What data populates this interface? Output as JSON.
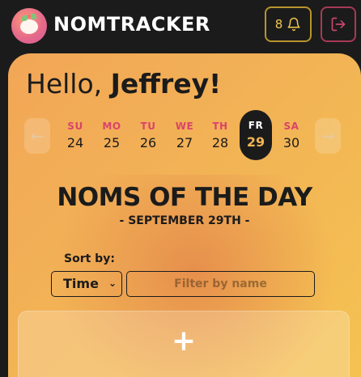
{
  "header": {
    "app_name": "NOMTRACKER",
    "notification_count": "8",
    "icons": {
      "logo": "nomtracker-logo-icon",
      "bell": "bell-icon",
      "logout": "logout-icon"
    }
  },
  "greeting": {
    "prefix": "Hello, ",
    "name": "Jeffrey!"
  },
  "week": {
    "prev_icon": "arrow-left-icon",
    "next_icon": "arrow-right-icon",
    "days": [
      {
        "label": "SU",
        "date": "24"
      },
      {
        "label": "MO",
        "date": "25"
      },
      {
        "label": "TU",
        "date": "26"
      },
      {
        "label": "WE",
        "date": "27"
      },
      {
        "label": "TH",
        "date": "28"
      },
      {
        "label": "FR",
        "date": "29",
        "selected": true
      },
      {
        "label": "SA",
        "date": "30"
      }
    ]
  },
  "noms": {
    "title": "NOMS OF THE DAY",
    "date": "- SEPTEMBER 29TH -"
  },
  "sort": {
    "label": "Sort by:",
    "selected": "Time"
  },
  "filter": {
    "placeholder": "Filter by name",
    "value": ""
  },
  "add": {
    "label": "+"
  },
  "colors": {
    "accent": "#f2b455",
    "day_label": "#d9446a",
    "dark": "#1b1b1b"
  }
}
